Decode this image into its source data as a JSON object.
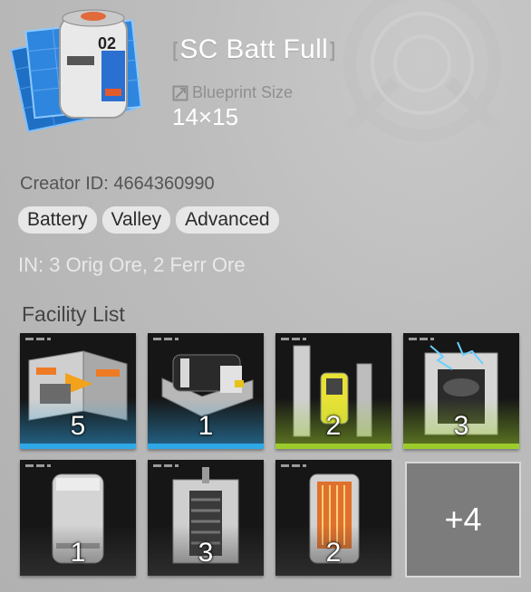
{
  "blueprint": {
    "title": "SC Batt Full",
    "bracket_open": "[",
    "bracket_close": "]",
    "size_label": "Blueprint Size",
    "size_value": "14×15",
    "creator": "Creator ID: 4664360990",
    "tags": [
      "Battery",
      "Valley",
      "Advanced"
    ],
    "inputs": "IN: 3 Orig Ore, 2 Ferr Ore",
    "thumb_code": "02"
  },
  "facilities": {
    "title": "Facility List",
    "items": [
      {
        "count": "5",
        "accent": "#2fa8e8",
        "icon": "refining-unit-icon"
      },
      {
        "count": "1",
        "accent": "#2fa8e8",
        "icon": "shredding-unit-icon"
      },
      {
        "count": "2",
        "accent": "#9ccc2c",
        "icon": "fitting-unit-icon"
      },
      {
        "count": "3",
        "accent": "#9ccc2c",
        "icon": "power-pylon-icon"
      },
      {
        "count": "1",
        "accent": "#2a2a2a",
        "icon": "storage-unit-icon"
      },
      {
        "count": "3",
        "accent": "#2a2a2a",
        "icon": "mining-drill-icon"
      },
      {
        "count": "2",
        "accent": "#2a2a2a",
        "icon": "thermal-bank-icon"
      }
    ],
    "more_label": "+4"
  },
  "colors": {
    "title": "#ffffff",
    "accent_blue": "#2fa8e8",
    "accent_green": "#9ccc2c",
    "tag_bg": "#e7e7e7"
  }
}
